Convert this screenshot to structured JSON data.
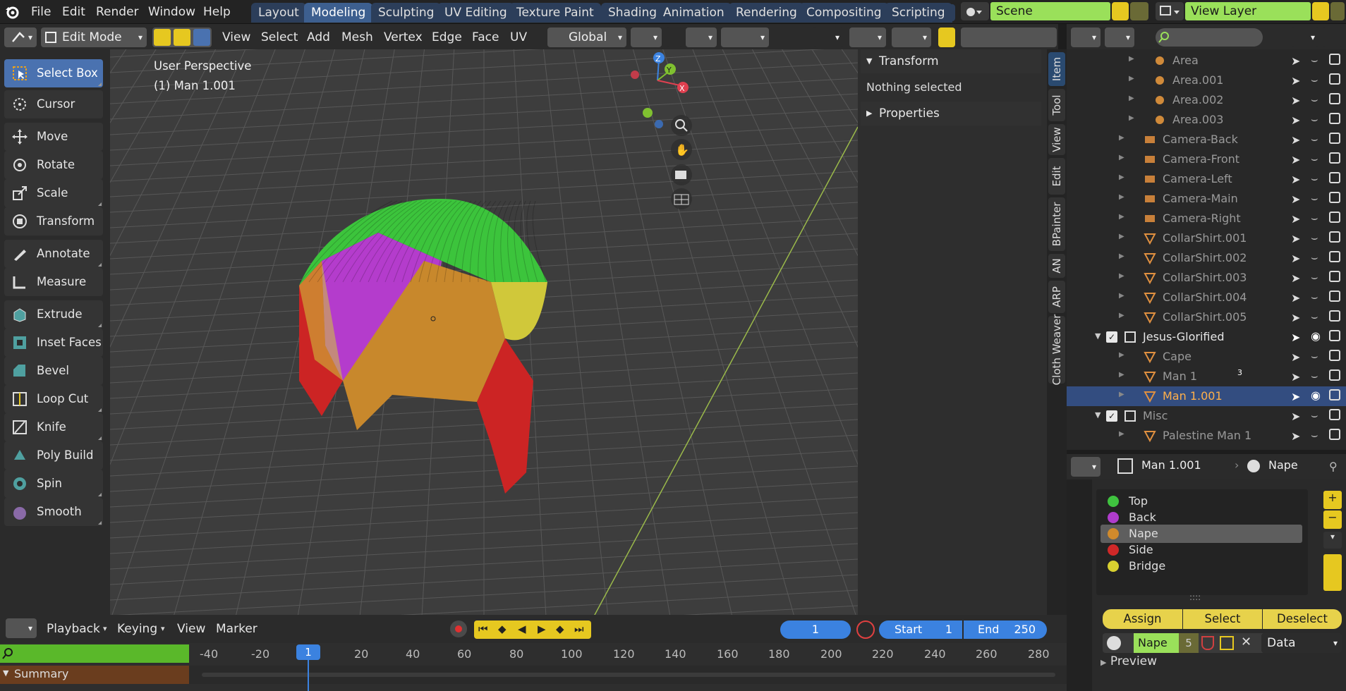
{
  "menubar": {
    "items": [
      "File",
      "Edit",
      "Render",
      "Window",
      "Help"
    ],
    "workspaces": [
      "Layout",
      "Modeling",
      "Sculpting",
      "UV Editing",
      "Texture Paint",
      "Shading",
      "Animation",
      "Rendering",
      "Compositing",
      "Scripting"
    ],
    "active_workspace": "Modeling",
    "scene": "Scene",
    "view_layer": "View Layer"
  },
  "viewport_header": {
    "mode": "Edit Mode",
    "menus": [
      "View",
      "Select",
      "Add",
      "Mesh",
      "Vertex",
      "Edge",
      "Face",
      "UV"
    ],
    "orientation": "Global"
  },
  "toolbar": {
    "tools": [
      "Select Box",
      "Cursor",
      "Move",
      "Rotate",
      "Scale",
      "Transform",
      "Annotate",
      "Measure",
      "Extrude Region",
      "Inset Faces",
      "Bevel",
      "Loop Cut",
      "Knife",
      "Poly Build",
      "Spin",
      "Smooth"
    ]
  },
  "viewport": {
    "perspective": "User Perspective",
    "object": "(1) Man 1.001",
    "gizmo_axes": [
      "Z",
      "Y",
      "X"
    ]
  },
  "npanel": {
    "transform_title": "Transform",
    "nothing_selected": "Nothing selected",
    "properties_title": "Properties",
    "tabs": [
      "Item",
      "Tool",
      "View",
      "Edit",
      "BPainter",
      "AN",
      "ARP",
      "Cloth Weaver"
    ]
  },
  "outliner": {
    "rows": [
      {
        "name": "Area",
        "dim": true
      },
      {
        "name": "Area.001",
        "dim": true
      },
      {
        "name": "Area.002",
        "dim": true
      },
      {
        "name": "Area.003",
        "dim": true
      },
      {
        "name": "Camera-Back",
        "dim": true
      },
      {
        "name": "Camera-Front",
        "dim": true
      },
      {
        "name": "Camera-Left",
        "dim": true
      },
      {
        "name": "Camera-Main",
        "dim": true
      },
      {
        "name": "Camera-Right",
        "dim": true
      },
      {
        "name": "CollarShirt.001",
        "dim": true
      },
      {
        "name": "CollarShirt.002",
        "dim": true
      },
      {
        "name": "CollarShirt.003",
        "dim": true
      },
      {
        "name": "CollarShirt.004",
        "dim": true
      },
      {
        "name": "CollarShirt.005",
        "dim": true
      },
      {
        "name": "Jesus-Glorified",
        "dim": false
      },
      {
        "name": "Cape",
        "dim": true
      },
      {
        "name": "Man 1",
        "dim": true
      },
      {
        "name": "Man 1.001",
        "dim": false
      },
      {
        "name": "Misc",
        "dim": true
      },
      {
        "name": "Palestine Man 1",
        "dim": true
      }
    ],
    "man1_badge": "3"
  },
  "properties": {
    "object": "Man 1.001",
    "material": "Nape",
    "slots": [
      {
        "name": "Top",
        "color": "#3fc23f"
      },
      {
        "name": "Back",
        "color": "#b03ccc"
      },
      {
        "name": "Nape",
        "color": "#d08a2c"
      },
      {
        "name": "Side",
        "color": "#d02828"
      },
      {
        "name": "Bridge",
        "color": "#d8d030"
      }
    ],
    "buttons": [
      "Assign",
      "Select",
      "Deselect"
    ],
    "users": "5",
    "link": "Data",
    "preview": "Preview"
  },
  "timeline": {
    "menus": [
      "Playback",
      "Keying",
      "View",
      "Marker"
    ],
    "current_frame": "1",
    "start_label": "Start",
    "start": "1",
    "end_label": "End",
    "end": "250",
    "ticks": [
      "-40",
      "-20",
      "20",
      "40",
      "60",
      "80",
      "100",
      "120",
      "140",
      "160",
      "180",
      "200",
      "220",
      "240",
      "260",
      "280"
    ],
    "summary": "Summary"
  },
  "colors": {
    "accent": "#4a72b0",
    "highlight": "#ffb04a",
    "scene": "#9ae05a"
  }
}
